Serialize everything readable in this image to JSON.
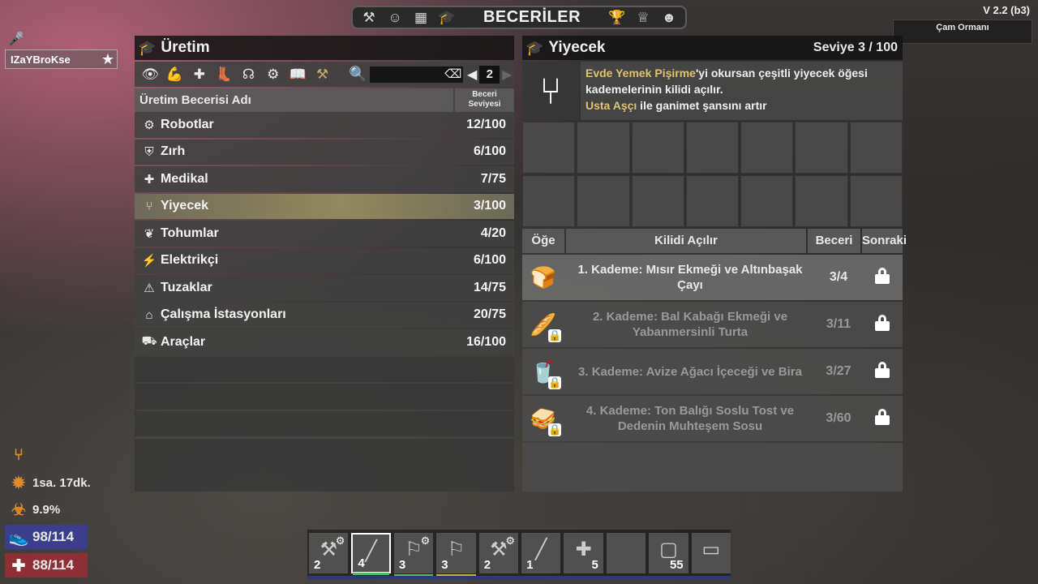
{
  "topbar": {
    "title": "BECERİLER",
    "icons": [
      "hammer-icon",
      "character-icon",
      "map-icon",
      "skills-icon",
      "challenges-icon",
      "trophy-icon",
      "party-icon"
    ]
  },
  "version": "V 2.2 (b3)",
  "biome": "Çam Ormanı",
  "player": {
    "name": "IZaYBroKse"
  },
  "left_panel": {
    "title": "Üretim",
    "search_placeholder": "",
    "page": "2",
    "col_name": "Üretim Becerisi Adı",
    "col_level_line1": "Beceri",
    "col_level_line2": "Seviyesi",
    "skills": [
      {
        "icon": "⚙",
        "name": "Robotlar",
        "level": "12/100"
      },
      {
        "icon": "⛨",
        "name": "Zırh",
        "level": "6/100"
      },
      {
        "icon": "✚",
        "name": "Medikal",
        "level": "7/75"
      },
      {
        "icon": "⑂",
        "name": "Yiyecek",
        "level": "3/100"
      },
      {
        "icon": "❦",
        "name": "Tohumlar",
        "level": "4/20"
      },
      {
        "icon": "⚡",
        "name": "Elektrikçi",
        "level": "6/100"
      },
      {
        "icon": "⚠",
        "name": "Tuzaklar",
        "level": "14/75"
      },
      {
        "icon": "⌂",
        "name": "Çalışma İstasyonları",
        "level": "20/75"
      },
      {
        "icon": "⛟",
        "name": "Araçlar",
        "level": "16/100"
      }
    ]
  },
  "right_panel": {
    "title": "Yiyecek",
    "level": "Seviye 3 / 100",
    "desc_gold_1": "Evde Yemek Pişirme",
    "desc_text_1": "'yi okursan çeşitli yiyecek öğesi kademelerinin kilidi açılır.",
    "desc_gold_2": "Usta Aşçı",
    "desc_text_2": " ile ganimet şansını artır",
    "col_item": "Öğe",
    "col_unlocks": "Kilidi Açılır",
    "col_skill": "Beceri",
    "col_next": "Sonraki",
    "tiers": [
      {
        "name": "1. Kademe: Mısır Ekmeği ve Altınbaşak Çayı",
        "skill": "3/4",
        "icon": "bread-icon"
      },
      {
        "name": "2. Kademe: Bal Kabağı Ekmeği ve Yabanmersinli Turta",
        "skill": "3/11",
        "icon": "pumpkin-bread-icon"
      },
      {
        "name": "3. Kademe: Avize Ağacı İçeceği ve Bira",
        "skill": "3/27",
        "icon": "drink-icon"
      },
      {
        "name": "4. Kademe: Ton Balığı Soslu Tost ve Dedenin Muhteşem Sosu",
        "skill": "3/60",
        "icon": "toast-icon"
      }
    ]
  },
  "stats": {
    "time": "1sa. 17dk.",
    "infection": "9.9%",
    "stamina": "98/114",
    "health": "88/114"
  },
  "toolbelt": [
    {
      "count": "2",
      "glyph": "⚒"
    },
    {
      "count": "4",
      "glyph": "╱"
    },
    {
      "count": "3",
      "glyph": "⚐"
    },
    {
      "count": "3",
      "glyph": "⚐"
    },
    {
      "count": "2",
      "glyph": "⚒"
    },
    {
      "count": "1",
      "glyph": "╱"
    },
    {
      "count": "5",
      "glyph": "✚"
    },
    {
      "count": "",
      "glyph": ""
    },
    {
      "count": "55",
      "glyph": "▢"
    },
    {
      "count": "",
      "glyph": "▭"
    }
  ]
}
